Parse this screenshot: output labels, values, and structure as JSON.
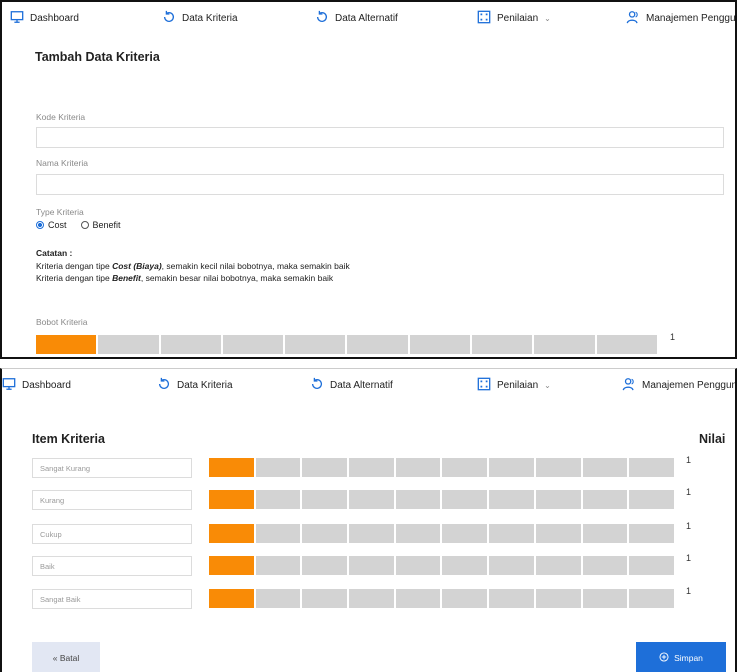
{
  "nav": {
    "dashboard": "Dashboard",
    "data_kriteria": "Data Kriteria",
    "data_alternatif": "Data Alternatif",
    "penilaian": "Penilaian",
    "manajemen": "Manajemen Pengguna"
  },
  "form": {
    "title": "Tambah Data Kriteria",
    "kode_label": "Kode Kriteria",
    "kode_value": "",
    "nama_label": "Nama Kriteria",
    "nama_value": "",
    "type_label": "Type Kriteria",
    "type_options": [
      "Cost",
      "Benefit"
    ],
    "type_selected": "Cost",
    "note_title": "Catatan :",
    "note_line1_pre": "Kriteria dengan tipe ",
    "note_line1_em": "Cost (Biaya)",
    "note_line1_post": ", semakin kecil nilai bobotnya, maka semakin baik",
    "note_line2_pre": "Kriteria dengan tipe ",
    "note_line2_em": "Benefit",
    "note_line2_post": ", semakin besar nilai bobotnya, maka semakin baik",
    "bobot_label": "Bobot Kriteria",
    "bobot_value": "1",
    "bobot_level": 1,
    "bobot_segments": 10
  },
  "items": {
    "title": "Item Kriteria",
    "nilai_header": "Nilai",
    "rows": [
      {
        "placeholder": "Sangat Kurang",
        "value": "1",
        "level": 1
      },
      {
        "placeholder": "Kurang",
        "value": "1",
        "level": 1
      },
      {
        "placeholder": "Cukup",
        "value": "1",
        "level": 1
      },
      {
        "placeholder": "Baik",
        "value": "1",
        "level": 1
      },
      {
        "placeholder": "Sangat Baik",
        "value": "1",
        "level": 1
      }
    ],
    "segments": 10
  },
  "buttons": {
    "batal": "« Batal",
    "simpan": "Simpan"
  },
  "colors": {
    "accent": "#1e6fd9",
    "slider_active": "#f98b06",
    "slider_inactive": "#d3d3d3"
  }
}
